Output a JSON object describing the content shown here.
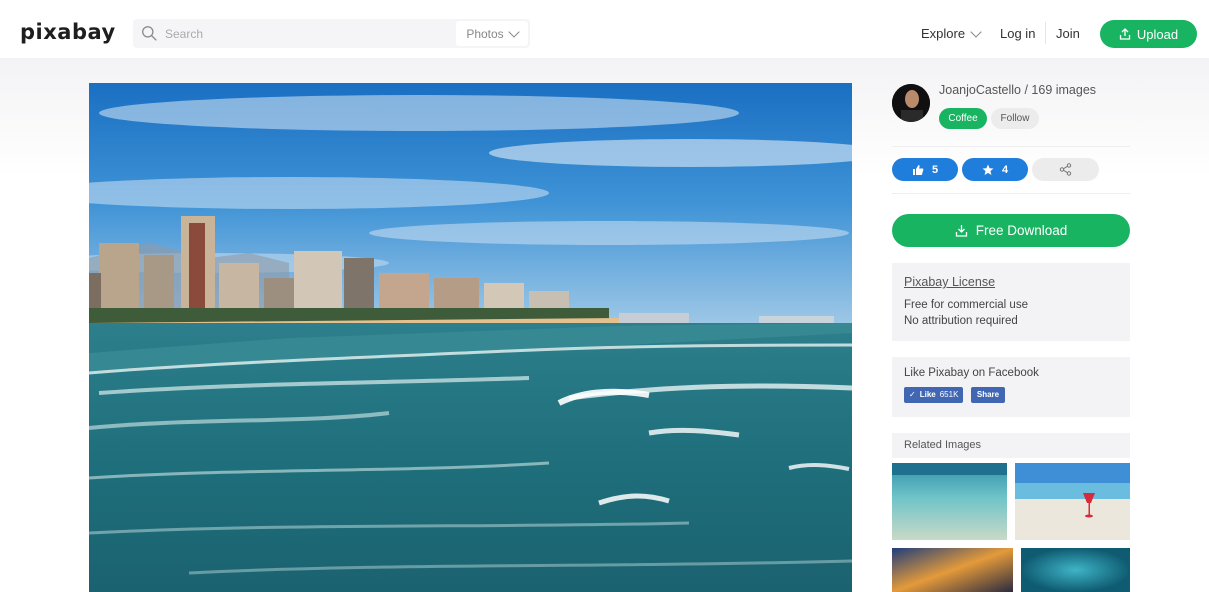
{
  "header": {
    "logo": "pixabay",
    "search": {
      "placeholder": "Search",
      "type_label": "Photos"
    },
    "nav": {
      "explore": "Explore",
      "login": "Log in",
      "join": "Join",
      "upload": "Upload"
    }
  },
  "sidebar": {
    "author": "JoanjoCastello / 169 images",
    "coffee": "Coffee",
    "follow": "Follow",
    "likes": "5",
    "favorites": "4",
    "download": "Free Download",
    "license": {
      "title": "Pixabay License",
      "line1": "Free for commercial use",
      "line2": "No attribution required"
    },
    "facebook": {
      "title": "Like Pixabay on Facebook",
      "like": "Like",
      "like_count": "651K",
      "share": "Share"
    },
    "related_title": "Related Images"
  },
  "colors": {
    "accent_green": "#19b462",
    "accent_blue": "#1f7ddc",
    "facebook_blue": "#4267b2"
  }
}
